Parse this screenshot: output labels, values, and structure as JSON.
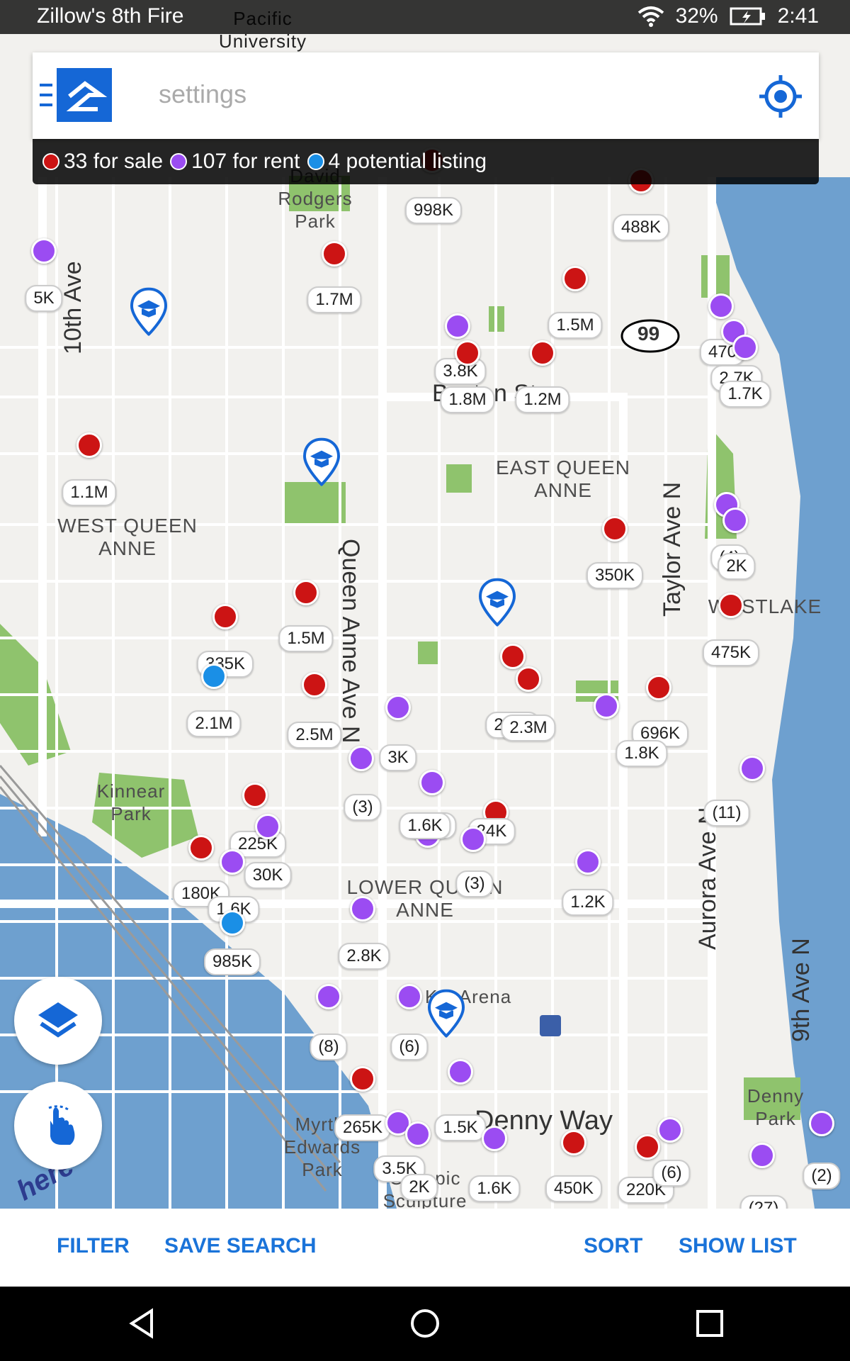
{
  "status_bar": {
    "app_name": "Zillow's 8th Fire",
    "battery": "32%",
    "time": "2:41"
  },
  "search": {
    "placeholder": "settings",
    "menu_icon": "hamburger-icon",
    "logo_icon": "zillow-logo",
    "locate_icon": "crosshair-icon"
  },
  "legend": {
    "for_sale": "33 for sale",
    "for_rent": "107 for rent",
    "potential": "4 potential listing",
    "colors": {
      "sale": "#cc1414",
      "rent": "#9b4cf2",
      "potential": "#1a8fe6"
    }
  },
  "map": {
    "neighborhoods": [
      {
        "name": "WEST QUEEN ANNE"
      },
      {
        "name": "EAST QUEEN ANNE"
      },
      {
        "name": "LOWER QUEEN ANNE"
      },
      {
        "name": "WESTLAKE"
      }
    ],
    "streets": [
      {
        "name": "Queen Anne Ave N"
      },
      {
        "name": "Taylor Ave N"
      },
      {
        "name": "Aurora Ave N"
      },
      {
        "name": "9th Ave N"
      },
      {
        "name": "Boston St"
      },
      {
        "name": "Denny Way"
      },
      {
        "name": "10th Ave"
      }
    ],
    "places": [
      {
        "name": "David Rodgers Park"
      },
      {
        "name": "Kinnear Park"
      },
      {
        "name": "Myrtle Edwards Park"
      },
      {
        "name": "Denny Park"
      },
      {
        "name": "Pacific University"
      },
      {
        "name": "KeyArena"
      },
      {
        "name": "Olympic Sculpture"
      }
    ],
    "highway_shield": "99",
    "price_labels": [
      {
        "text": "998K",
        "type": "sale"
      },
      {
        "text": "488K",
        "type": "sale"
      },
      {
        "text": "5K",
        "type": "rent"
      },
      {
        "text": "1.7M",
        "type": "sale"
      },
      {
        "text": "1.5M",
        "type": "sale"
      },
      {
        "text": "470",
        "type": "rent"
      },
      {
        "text": "2.7K",
        "type": "rent"
      },
      {
        "text": "1.7K",
        "type": "rent"
      },
      {
        "text": "3.8K",
        "type": "rent"
      },
      {
        "text": "1.8M",
        "type": "sale"
      },
      {
        "text": "1.2M",
        "type": "sale"
      },
      {
        "text": "1.1M",
        "type": "sale"
      },
      {
        "text": "(4)",
        "type": "rent"
      },
      {
        "text": "2K",
        "type": "rent"
      },
      {
        "text": "350K",
        "type": "sale"
      },
      {
        "text": "1.5M",
        "type": "sale"
      },
      {
        "text": "335K",
        "type": "sale"
      },
      {
        "text": "475K",
        "type": "sale"
      },
      {
        "text": "2.1M",
        "type": "potential"
      },
      {
        "text": "2.5M",
        "type": "sale"
      },
      {
        "text": "2.6M",
        "type": "sale"
      },
      {
        "text": "2.3M",
        "type": "sale"
      },
      {
        "text": "696K",
        "type": "sale"
      },
      {
        "text": "1.8K",
        "type": "rent"
      },
      {
        "text": "3K",
        "type": "rent"
      },
      {
        "text": "(3)",
        "type": "rent"
      },
      {
        "text": "1.6K",
        "type": "rent"
      },
      {
        "text": "225K",
        "type": "sale"
      },
      {
        "text": "24K",
        "type": "sale"
      },
      {
        "text": "(11)",
        "type": "rent"
      },
      {
        "text": "180K",
        "type": "sale"
      },
      {
        "text": "1.6K",
        "type": "rent"
      },
      {
        "text": "30K",
        "type": "rent"
      },
      {
        "text": "(3)",
        "type": "rent"
      },
      {
        "text": "1.6K",
        "type": "rent"
      },
      {
        "text": "1.2K",
        "type": "rent"
      },
      {
        "text": "985K",
        "type": "potential"
      },
      {
        "text": "2.8K",
        "type": "rent"
      },
      {
        "text": "(8)",
        "type": "rent"
      },
      {
        "text": "(6)",
        "type": "rent"
      },
      {
        "text": "265K",
        "type": "sale"
      },
      {
        "text": "1.5K",
        "type": "rent"
      },
      {
        "text": "3.5K",
        "type": "rent"
      },
      {
        "text": "2K",
        "type": "rent"
      },
      {
        "text": "1.6K",
        "type": "rent"
      },
      {
        "text": "450K",
        "type": "sale"
      },
      {
        "text": "220K",
        "type": "sale"
      },
      {
        "text": "(6)",
        "type": "rent"
      },
      {
        "text": "(27)",
        "type": "rent"
      },
      {
        "text": "(2)",
        "type": "rent"
      }
    ],
    "attribution": "here"
  },
  "fab": {
    "layers_icon": "layers-icon",
    "draw_icon": "draw-hand-icon"
  },
  "bottom_bar": {
    "filter": "FILTER",
    "save_search": "SAVE SEARCH",
    "sort": "SORT",
    "show_list": "SHOW LIST"
  },
  "nav_bar": {
    "back": "back-icon",
    "home": "home-icon",
    "recents": "recents-icon"
  }
}
